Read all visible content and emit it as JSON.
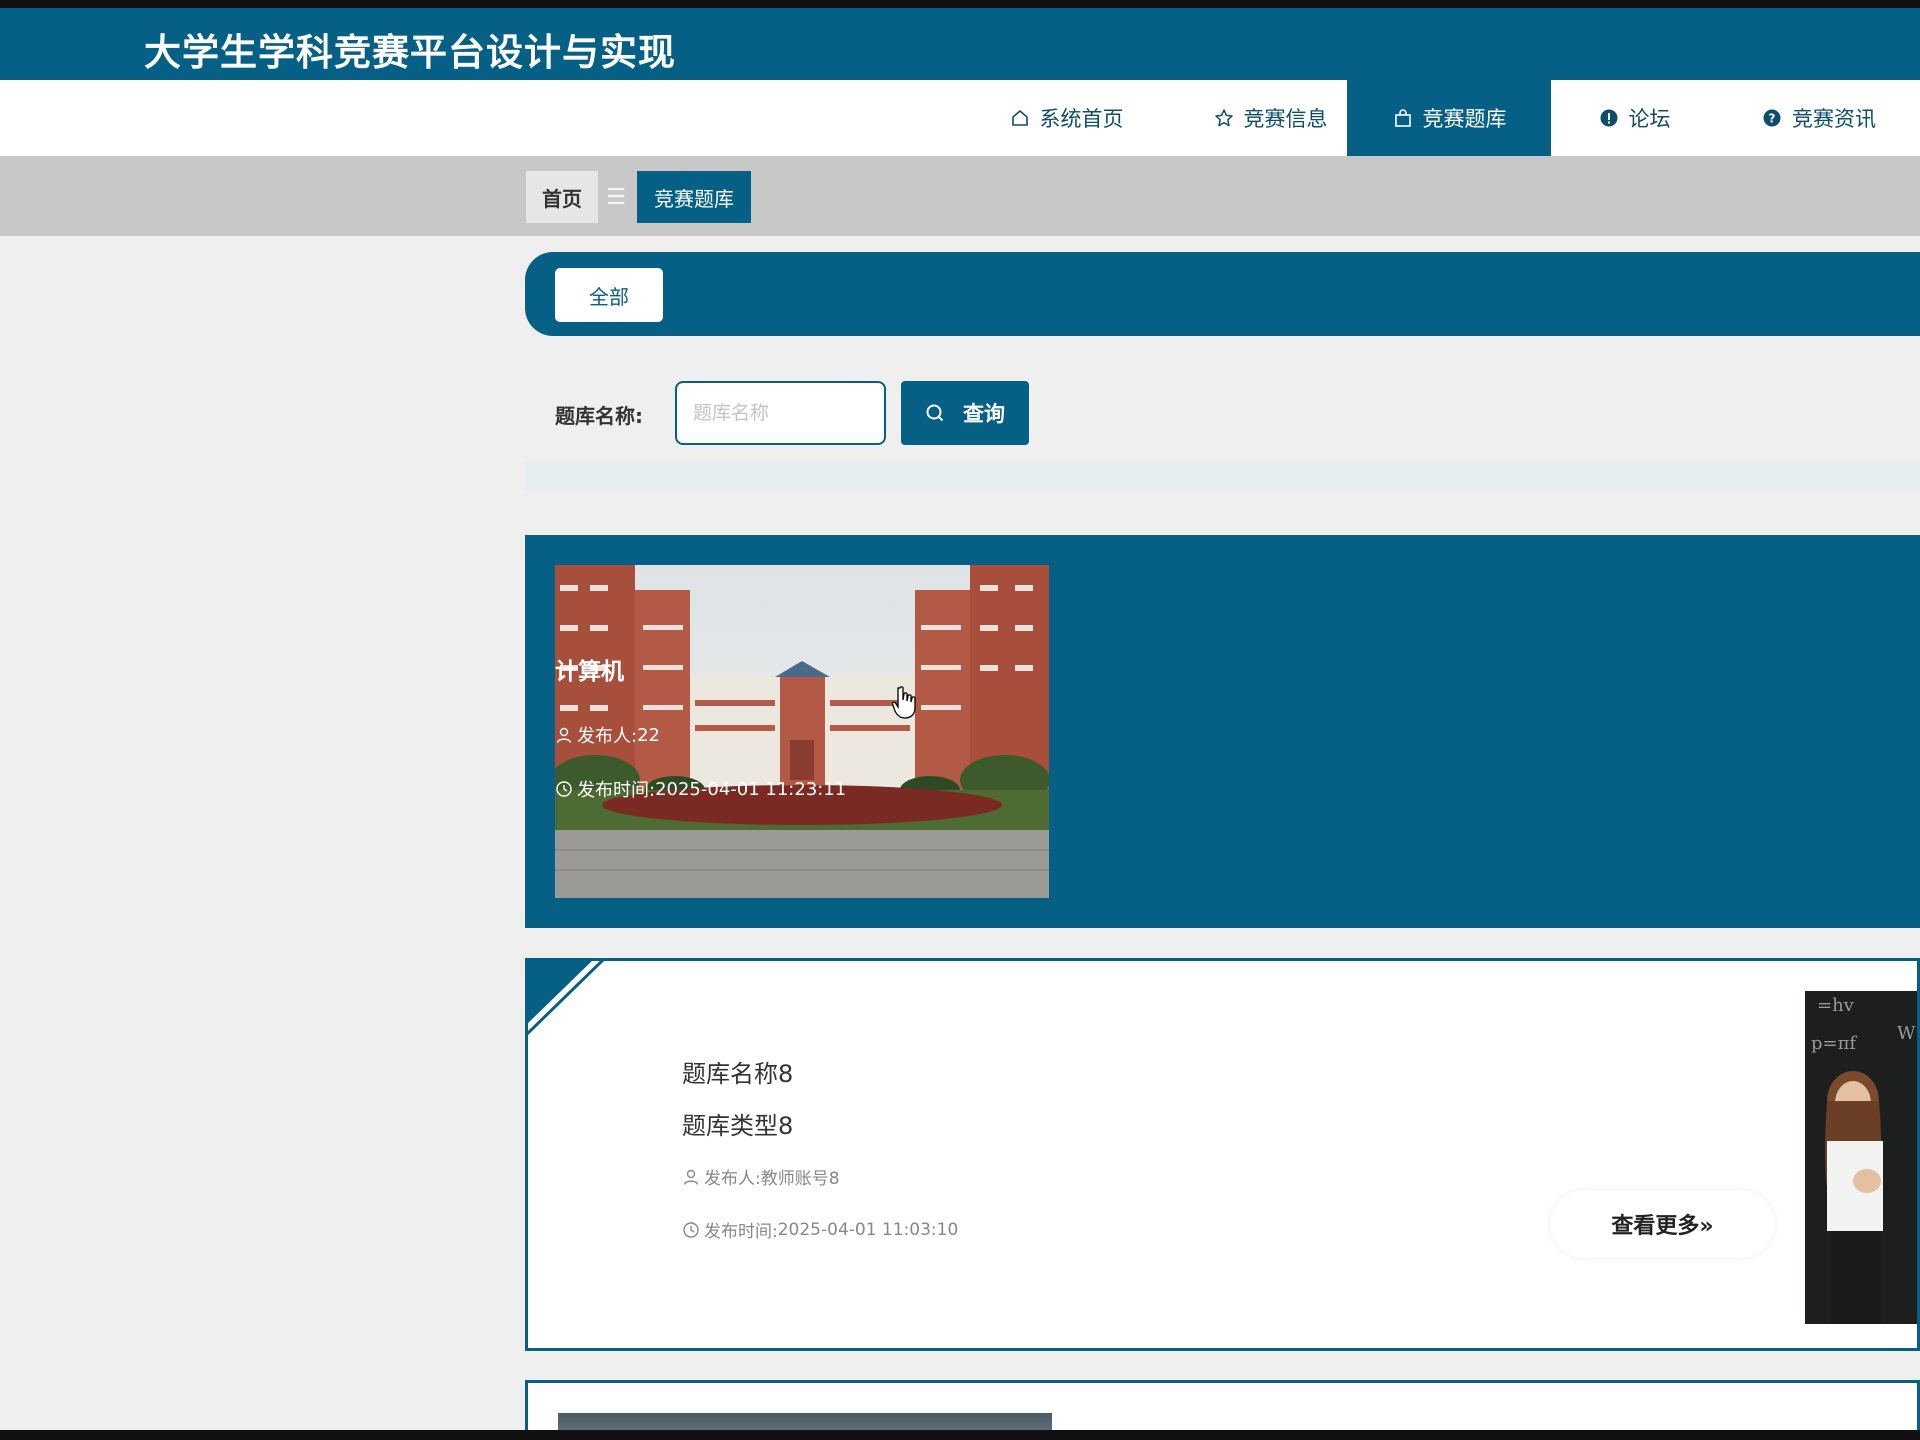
{
  "header": {
    "site_title": "大学生学科竞赛平台设计与实现"
  },
  "nav": {
    "items": [
      {
        "label": "系统首页",
        "icon": "home-icon"
      },
      {
        "label": "竞赛信息",
        "icon": "star-icon"
      },
      {
        "label": "竞赛题库",
        "icon": "bag-icon",
        "active": true
      },
      {
        "label": "论坛",
        "icon": "info-icon"
      },
      {
        "label": "竞赛资讯",
        "icon": "help-icon"
      }
    ]
  },
  "breadcrumb": {
    "home": "首页",
    "separator": "☰",
    "current": "竞赛题库"
  },
  "filter": {
    "all_tab": "全部"
  },
  "search": {
    "label": "题库名称:",
    "placeholder": "题库名称",
    "value": "",
    "button": "查询"
  },
  "cards": [
    {
      "title": "计算机",
      "publisher_label": "发布人:",
      "publisher": "22",
      "time_label": "发布时间:",
      "time": "2025-04-01 11:23:11",
      "image": "campus-building-photo"
    },
    {
      "title": "题库名称8",
      "type": "题库类型8",
      "publisher_label": "发布人:",
      "publisher": "教师账号8",
      "time_label": "发布时间:",
      "time": "2025-04-01 11:03:10",
      "more": "查看更多»",
      "image": "girl-at-chalkboard-photo"
    }
  ],
  "colors": {
    "primary": "#065f84",
    "breadcrumb_bg": "#c8c8c8",
    "page_bg": "#efefef"
  }
}
